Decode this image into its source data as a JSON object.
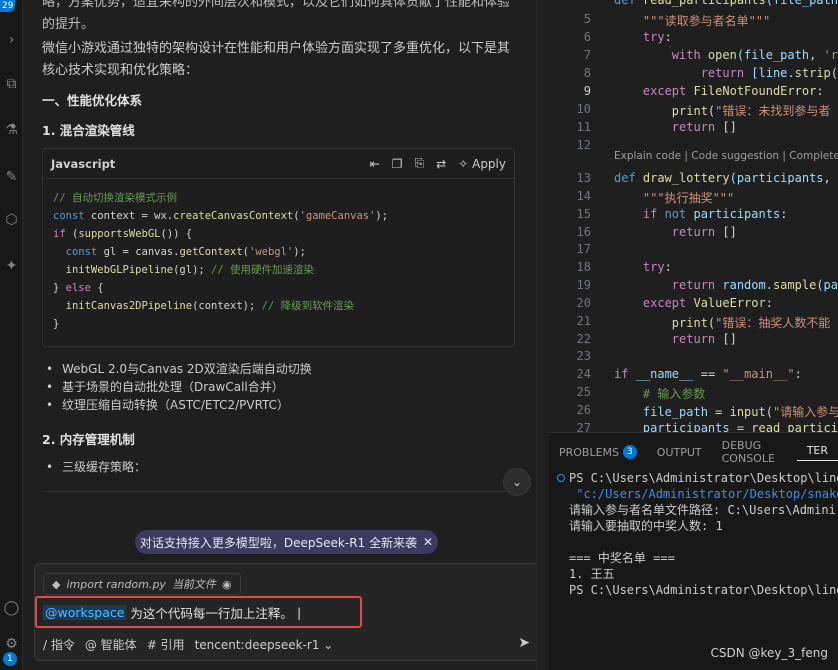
{
  "activity_bar": {
    "top_badge": "29",
    "bottom_badge": "1"
  },
  "chat": {
    "top_text": "略，方案优势，适宜采构的外间层次和模式，以及它们如何具体贡献了性能和体验的提升。",
    "intro": "微信小游戏通过独特的架构设计在性能和用户体验方面实现了多重优化，以下是其核心技术实现和优化策略：",
    "section1": "一、性能优化体系",
    "subsection1": "1. 混合渲染管线",
    "codeblock": {
      "lang": "Javascript",
      "apply_label": "Apply",
      "lines": [
        [
          {
            "t": "// 自动切换渲染模式示例",
            "c": "c-com"
          }
        ],
        [
          {
            "t": "const",
            "c": "c-kw2"
          },
          {
            "t": " context = wx.",
            "c": "c-pl"
          },
          {
            "t": "createCanvasContext",
            "c": "c-fn"
          },
          {
            "t": "(",
            "c": "c-pl"
          },
          {
            "t": "'gameCanvas'",
            "c": "c-str"
          },
          {
            "t": ");",
            "c": "c-pl"
          }
        ],
        [
          {
            "t": "if",
            "c": "c-kw"
          },
          {
            "t": " (",
            "c": "c-pl"
          },
          {
            "t": "supportsWebGL",
            "c": "c-fn"
          },
          {
            "t": "()) {",
            "c": "c-pl"
          }
        ],
        [
          {
            "t": "  const",
            "c": "c-kw2"
          },
          {
            "t": " gl = canvas.",
            "c": "c-pl"
          },
          {
            "t": "getContext",
            "c": "c-fn"
          },
          {
            "t": "(",
            "c": "c-pl"
          },
          {
            "t": "'webgl'",
            "c": "c-str"
          },
          {
            "t": ");",
            "c": "c-pl"
          }
        ],
        [
          {
            "t": "  initWebGLPipeline",
            "c": "c-fn"
          },
          {
            "t": "(gl); ",
            "c": "c-pl"
          },
          {
            "t": "// 使用硬件加速渲染",
            "c": "c-com"
          }
        ],
        [
          {
            "t": "} ",
            "c": "c-pl"
          },
          {
            "t": "else",
            "c": "c-kw"
          },
          {
            "t": " {",
            "c": "c-pl"
          }
        ],
        [
          {
            "t": "  initCanvas2DPipeline",
            "c": "c-fn"
          },
          {
            "t": "(context); ",
            "c": "c-pl"
          },
          {
            "t": "// 降级到软件渲染",
            "c": "c-com"
          }
        ],
        [
          {
            "t": "}",
            "c": "c-pl"
          }
        ]
      ]
    },
    "bullets": [
      "WebGL 2.0与Canvas 2D双渲染后端自动切换",
      "基于场景的自动批处理（DrawCall合并）",
      "纹理压缩自动转换（ASTC/ETC2/PVRTC）"
    ],
    "subsection2": "2. 内存管理机制",
    "bullet2": "三级缓存策略：",
    "notice": "对话支持接入更多模型啦，DeepSeek-R1 全新来袭",
    "input": {
      "file_chip": "import random.py",
      "file_chip_suffix": "当前文件",
      "mention": "@workspace",
      "text": "为这个代码每一行加上注释。",
      "footer_items": [
        "/ 指令",
        "@ 智能体",
        "# 引用",
        "tencent:deepseek-r1"
      ]
    }
  },
  "editor": {
    "lines": [
      {
        "n": "",
        "cur": false,
        "segs": [
          {
            "t": "def ",
            "c": "c-kw2"
          },
          {
            "t": "read_participants",
            "c": "c-fn"
          },
          {
            "t": "(file_path",
            "c": "c-var"
          }
        ]
      },
      {
        "n": "5",
        "cur": false,
        "segs": [
          {
            "t": "    \"\"\"读取参与者名单\"\"\"",
            "c": "c-str"
          }
        ]
      },
      {
        "n": "6",
        "cur": false,
        "segs": [
          {
            "t": "    try",
            "c": "c-kw"
          },
          {
            "t": ":",
            "c": "c-pl"
          }
        ]
      },
      {
        "n": "7",
        "cur": false,
        "segs": [
          {
            "t": "        with ",
            "c": "c-kw"
          },
          {
            "t": "open",
            "c": "c-fn"
          },
          {
            "t": "(file_path, ",
            "c": "c-var"
          },
          {
            "t": "'r",
            "c": "c-str"
          }
        ]
      },
      {
        "n": "8",
        "cur": false,
        "segs": [
          {
            "t": "            return ",
            "c": "c-kw"
          },
          {
            "t": "[line.",
            "c": "c-var"
          },
          {
            "t": "strip",
            "c": "c-fn"
          },
          {
            "t": "(",
            "c": "c-pl"
          }
        ]
      },
      {
        "n": "9",
        "cur": true,
        "segs": [
          {
            "t": "    except ",
            "c": "c-kw"
          },
          {
            "t": "FileNotFoundError",
            "c": "c-fn"
          },
          {
            "t": ":",
            "c": "c-pl"
          }
        ]
      },
      {
        "n": "10",
        "cur": false,
        "segs": [
          {
            "t": "        print",
            "c": "c-fn"
          },
          {
            "t": "(",
            "c": "c-pl"
          },
          {
            "t": "\"错误：未找到参与者",
            "c": "c-str"
          }
        ]
      },
      {
        "n": "11",
        "cur": false,
        "segs": [
          {
            "t": "        return ",
            "c": "c-kw"
          },
          {
            "t": "[]",
            "c": "c-pl"
          }
        ]
      },
      {
        "n": "12",
        "cur": false,
        "segs": []
      },
      {
        "n": "13",
        "cur": false,
        "segs": [
          {
            "t": "def ",
            "c": "c-kw2"
          },
          {
            "t": "draw_lottery",
            "c": "c-fn"
          },
          {
            "t": "(participants, ",
            "c": "c-var"
          }
        ]
      },
      {
        "n": "14",
        "cur": false,
        "segs": [
          {
            "t": "    \"\"\"执行抽奖\"\"\"",
            "c": "c-str"
          }
        ]
      },
      {
        "n": "15",
        "cur": false,
        "segs": [
          {
            "t": "    if ",
            "c": "c-kw"
          },
          {
            "t": "not ",
            "c": "c-kw2"
          },
          {
            "t": "participants",
            "c": "c-var"
          },
          {
            "t": ":",
            "c": "c-pl"
          }
        ]
      },
      {
        "n": "16",
        "cur": false,
        "segs": [
          {
            "t": "        return ",
            "c": "c-kw"
          },
          {
            "t": "[]",
            "c": "c-pl"
          }
        ]
      },
      {
        "n": "17",
        "cur": false,
        "segs": []
      },
      {
        "n": "18",
        "cur": false,
        "segs": [
          {
            "t": "    try",
            "c": "c-kw"
          },
          {
            "t": ":",
            "c": "c-pl"
          }
        ]
      },
      {
        "n": "19",
        "cur": false,
        "segs": [
          {
            "t": "        return ",
            "c": "c-kw"
          },
          {
            "t": "random.",
            "c": "c-var"
          },
          {
            "t": "sample",
            "c": "c-fn"
          },
          {
            "t": "(pa",
            "c": "c-var"
          }
        ]
      },
      {
        "n": "20",
        "cur": false,
        "segs": [
          {
            "t": "    except ",
            "c": "c-kw"
          },
          {
            "t": "ValueError",
            "c": "c-fn"
          },
          {
            "t": ":",
            "c": "c-pl"
          }
        ]
      },
      {
        "n": "21",
        "cur": false,
        "segs": [
          {
            "t": "        print",
            "c": "c-fn"
          },
          {
            "t": "(",
            "c": "c-pl"
          },
          {
            "t": "\"错误：抽奖人数不能",
            "c": "c-str"
          }
        ]
      },
      {
        "n": "22",
        "cur": false,
        "segs": [
          {
            "t": "        return ",
            "c": "c-kw"
          },
          {
            "t": "[]",
            "c": "c-pl"
          }
        ]
      },
      {
        "n": "23",
        "cur": false,
        "segs": []
      },
      {
        "n": "24",
        "cur": false,
        "segs": [
          {
            "t": "if ",
            "c": "c-kw"
          },
          {
            "t": "__name__ ",
            "c": "c-var"
          },
          {
            "t": "== ",
            "c": "c-pl"
          },
          {
            "t": "\"__main__\"",
            "c": "c-str"
          },
          {
            "t": ":",
            "c": "c-pl"
          }
        ]
      },
      {
        "n": "25",
        "cur": false,
        "segs": [
          {
            "t": "    # 输入参数",
            "c": "c-com"
          }
        ]
      },
      {
        "n": "26",
        "cur": false,
        "segs": [
          {
            "t": "    file_path ",
            "c": "c-var"
          },
          {
            "t": "= ",
            "c": "c-pl"
          },
          {
            "t": "input",
            "c": "c-fn"
          },
          {
            "t": "(",
            "c": "c-pl"
          },
          {
            "t": "\"请输入参与",
            "c": "c-str"
          }
        ]
      },
      {
        "n": "27",
        "cur": false,
        "segs": [
          {
            "t": "    participants ",
            "c": "c-var"
          },
          {
            "t": "= ",
            "c": "c-pl"
          },
          {
            "t": "read_partici",
            "c": "c-fn"
          }
        ]
      }
    ],
    "codelens": "Explain code | Code suggestion | Complete co"
  },
  "panel": {
    "tabs": [
      {
        "label": "PROBLEMS",
        "count": "3",
        "active": false
      },
      {
        "label": "OUTPUT",
        "count": "",
        "active": false
      },
      {
        "label": "DEBUG CONSOLE",
        "count": "",
        "active": false
      },
      {
        "label": "TER",
        "count": "",
        "active": true
      }
    ],
    "terminal_lines": [
      "PS C:\\Users\\Administrator\\Desktop\\lingma-",
      " \"c:/Users/Administrator/Desktop/snake/im",
      "请输入参与者名单文件路径: C:\\Users\\Admini",
      "请输入要抽取的中奖人数: 1",
      "",
      "=== 中奖名单 ===",
      "1. 王五",
      "PS C:\\Users\\Administrator\\Desktop\\lingma-"
    ]
  },
  "watermark": "CSDN @key_3_feng"
}
